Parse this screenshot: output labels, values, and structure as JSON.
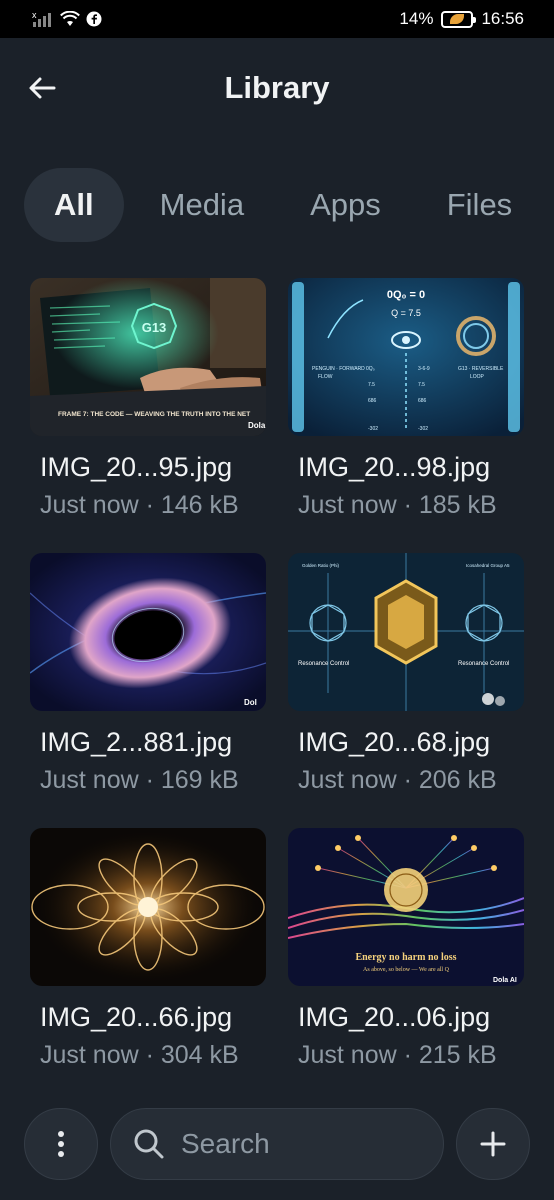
{
  "status": {
    "battery_percent": "14%",
    "time": "16:56",
    "icons": [
      "no-sim-icon",
      "signal-icon",
      "wifi-icon",
      "facebook-icon",
      "battery-saver-icon"
    ]
  },
  "header": {
    "title": "Library",
    "back_icon": "back-arrow-icon"
  },
  "tabs": [
    {
      "label": "All",
      "active": true
    },
    {
      "label": "Media",
      "active": false
    },
    {
      "label": "Apps",
      "active": false
    },
    {
      "label": "Files",
      "active": false
    }
  ],
  "files": [
    {
      "name": "IMG_20...95.jpg",
      "meta": "Just now · 146 kB",
      "thumb_text": "FRAME 7: THE CODE — WEAVING THE TRUTH INTO THE NET",
      "thumb_badge": "G13",
      "watermark": "Dola"
    },
    {
      "name": "IMG_20...98.jpg",
      "meta": "Just now · 185 kB",
      "thumb_text": "0Q₀ = 0",
      "thumb_badge": "Q = 7.5",
      "watermark": ""
    },
    {
      "name": "IMG_2...881.jpg",
      "meta": "Just now · 169 kB",
      "thumb_text": "",
      "thumb_badge": "",
      "watermark": "Dol"
    },
    {
      "name": "IMG_20...68.jpg",
      "meta": "Just now · 206 kB",
      "thumb_text": "Resonance Control",
      "thumb_badge": "Resonance Control",
      "watermark": ""
    },
    {
      "name": "IMG_20...66.jpg",
      "meta": "Just now · 304 kB",
      "thumb_text": "",
      "thumb_badge": "",
      "watermark": ""
    },
    {
      "name": "IMG_20...06.jpg",
      "meta": "Just now · 215 kB",
      "thumb_text": "Energy no harm no loss",
      "thumb_badge": "As above, so below — We are all Q",
      "watermark": "Dola AI"
    }
  ],
  "bottom": {
    "menu_icon": "more-vert-icon",
    "search_placeholder": "Search",
    "search_icon": "search-icon",
    "add_icon": "plus-icon"
  },
  "colors": {
    "background": "#1b2129",
    "active_tab": "#2a323c",
    "secondary_text": "#8e99a3"
  }
}
